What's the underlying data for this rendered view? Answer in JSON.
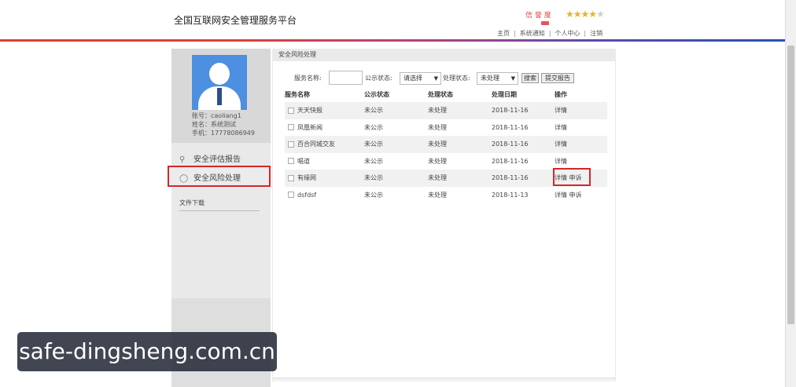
{
  "header": {
    "title": "全国互联网安全管理服务平台",
    "user_badge": "信 誉 度",
    "stars_on": "★★★★",
    "stars_off": "★",
    "nav": [
      "主页",
      "系统通知",
      "个人中心",
      "注销"
    ]
  },
  "sidebar": {
    "account": "账号：caoliang1",
    "name": "姓名：系统测试",
    "phone": "手机：17778086949",
    "items": [
      {
        "icon": "search-icon",
        "label": "安全评估报告"
      },
      {
        "icon": "shield-icon",
        "label": "安全风险处理"
      }
    ],
    "file_download": "文件下载"
  },
  "main": {
    "section_title": "安全风险处理",
    "filter": {
      "service_name_label": "服务名称:",
      "service_name_value": "",
      "public_status_label": "公示状态:",
      "public_status_value": "请选择",
      "process_status_label": "处理状态:",
      "process_status_value": "未处理",
      "search_button": "搜索",
      "submit_report_button": "提交报告"
    },
    "table": {
      "headers": [
        "服务名称",
        "公示状态",
        "处理状态",
        "处理日期",
        "操作"
      ],
      "rows": [
        {
          "name": "天天快报",
          "public": "未公示",
          "status": "未处理",
          "date": "2018-11-16",
          "actions": [
            "详情"
          ]
        },
        {
          "name": "凤凰新闻",
          "public": "未公示",
          "status": "未处理",
          "date": "2018-11-16",
          "actions": [
            "详情"
          ]
        },
        {
          "name": "百合同城交友",
          "public": "未公示",
          "status": "未处理",
          "date": "2018-11-16",
          "actions": [
            "详情"
          ]
        },
        {
          "name": "唱道",
          "public": "未公示",
          "status": "未处理",
          "date": "2018-11-16",
          "actions": [
            "详情"
          ]
        },
        {
          "name": "有缘网",
          "public": "未公示",
          "status": "未处理",
          "date": "2018-11-16",
          "actions": [
            "详情",
            "申诉"
          ]
        },
        {
          "name": "dsfdsf",
          "public": "未公示",
          "status": "未处理",
          "date": "2018-11-13",
          "actions": [
            "详情",
            "申诉"
          ]
        }
      ]
    }
  },
  "watermark": "safe-dingsheng.com.cn",
  "colors": {
    "accent_red": "#d6262a",
    "avatar_blue": "#4d8fe0",
    "star_gold": "#e9b322"
  }
}
